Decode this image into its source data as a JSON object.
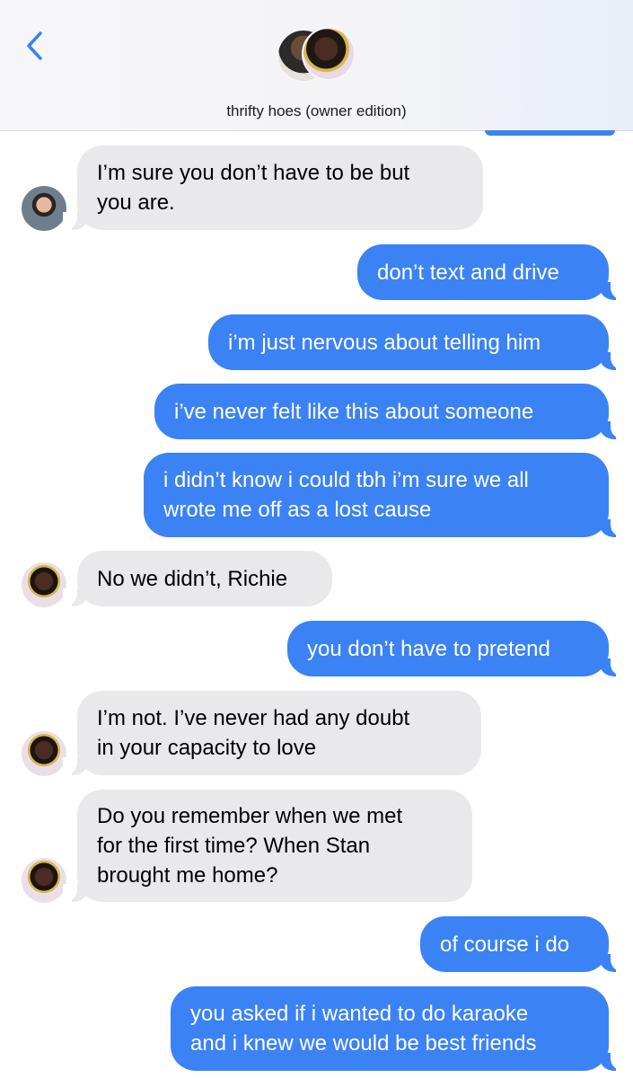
{
  "header": {
    "back_icon": "chevron-left-icon",
    "group_name": "thrifty hoes (owner edition)"
  },
  "colors": {
    "outgoing_bubble": "#3b82f5",
    "incoming_bubble": "#e9e9eb",
    "back_chevron": "#3b82f5"
  },
  "messages": [
    {
      "direction": "incoming",
      "sender_avatar": "man-avatar",
      "text": "I’m sure you don’t have to be but\nyou are."
    },
    {
      "direction": "outgoing",
      "text": "don’t text and drive"
    },
    {
      "direction": "outgoing",
      "text": "i’m just nervous about telling him"
    },
    {
      "direction": "outgoing",
      "text": "i’ve never felt like this about someone"
    },
    {
      "direction": "outgoing",
      "text": "i didn’t know i could tbh i’m sure we all\nwrote me off as a lost cause"
    },
    {
      "direction": "incoming",
      "sender_avatar": "woman-avatar",
      "text": "No we didn’t, Richie"
    },
    {
      "direction": "outgoing",
      "text": "you don’t have to pretend"
    },
    {
      "direction": "incoming",
      "sender_avatar": "woman-avatar",
      "text": "I’m not. I’ve never had any doubt\nin your capacity to love"
    },
    {
      "direction": "incoming",
      "sender_avatar": "woman-avatar",
      "text": "Do you remember when we met\nfor the first time? When Stan\nbrought me home?"
    },
    {
      "direction": "outgoing",
      "text": "of course i do"
    },
    {
      "direction": "outgoing",
      "text": "you asked if i wanted to do karaoke\nand i knew we would be best friends"
    }
  ]
}
